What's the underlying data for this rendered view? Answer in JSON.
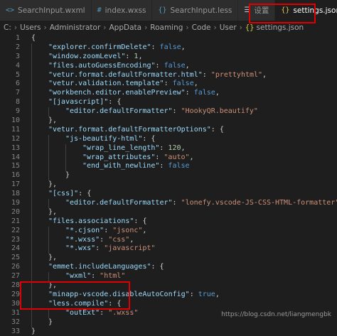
{
  "tabs": [
    {
      "label": "SearchInput.wxml",
      "icon": "file-code-icon",
      "active": false
    },
    {
      "label": "index.wxss",
      "icon": "hash-icon",
      "active": false
    },
    {
      "label": "SearchInput.less",
      "icon": "braces-icon",
      "active": false
    },
    {
      "label": "设置",
      "icon": "gear-icon",
      "active": false
    },
    {
      "label": "settings.json",
      "icon": "braces-icon",
      "active": true,
      "close_glyph": "×"
    }
  ],
  "breadcrumb": [
    "C:",
    "Users",
    "Administrator",
    "AppData",
    "Roaming",
    "Code",
    "User",
    "settings.json"
  ],
  "editor": {
    "line_numbers": [
      "1",
      "2",
      "3",
      "4",
      "5",
      "6",
      "7",
      "8",
      "9",
      "10",
      "11",
      "12",
      "13",
      "14",
      "15",
      "16",
      "17",
      "18",
      "19",
      "20",
      "21",
      "22",
      "23",
      "24",
      "25",
      "26",
      "27",
      "28",
      "29",
      "30",
      "31",
      "32",
      "33"
    ],
    "lines": [
      {
        "indent": 0,
        "parts": [
          {
            "t": "punc",
            "v": "{"
          }
        ]
      },
      {
        "indent": 1,
        "parts": [
          {
            "t": "key",
            "v": "\"explorer.confirmDelete\""
          },
          {
            "t": "punc",
            "v": ": "
          },
          {
            "t": "bool",
            "v": "false"
          },
          {
            "t": "punc",
            "v": ","
          }
        ]
      },
      {
        "indent": 1,
        "parts": [
          {
            "t": "key",
            "v": "\"window.zoomLevel\""
          },
          {
            "t": "punc",
            "v": ": "
          },
          {
            "t": "num",
            "v": "1"
          },
          {
            "t": "punc",
            "v": ","
          }
        ]
      },
      {
        "indent": 1,
        "parts": [
          {
            "t": "key",
            "v": "\"files.autoGuessEncoding\""
          },
          {
            "t": "punc",
            "v": ": "
          },
          {
            "t": "bool",
            "v": "false"
          },
          {
            "t": "punc",
            "v": ","
          }
        ]
      },
      {
        "indent": 1,
        "parts": [
          {
            "t": "key",
            "v": "\"vetur.format.defaultFormatter.html\""
          },
          {
            "t": "punc",
            "v": ": "
          },
          {
            "t": "str",
            "v": "\"prettyhtml\""
          },
          {
            "t": "punc",
            "v": ","
          }
        ]
      },
      {
        "indent": 1,
        "parts": [
          {
            "t": "key",
            "v": "\"vetur.validation.template\""
          },
          {
            "t": "punc",
            "v": ": "
          },
          {
            "t": "bool",
            "v": "false"
          },
          {
            "t": "punc",
            "v": ","
          }
        ]
      },
      {
        "indent": 1,
        "parts": [
          {
            "t": "key",
            "v": "\"workbench.editor.enablePreview\""
          },
          {
            "t": "punc",
            "v": ": "
          },
          {
            "t": "bool",
            "v": "false"
          },
          {
            "t": "punc",
            "v": ","
          }
        ]
      },
      {
        "indent": 1,
        "parts": [
          {
            "t": "key",
            "v": "\"[javascript]\""
          },
          {
            "t": "punc",
            "v": ": {"
          }
        ]
      },
      {
        "indent": 2,
        "parts": [
          {
            "t": "key",
            "v": "\"editor.defaultFormatter\""
          },
          {
            "t": "punc",
            "v": ": "
          },
          {
            "t": "str",
            "v": "\"HookyQR.beautify\""
          }
        ]
      },
      {
        "indent": 1,
        "parts": [
          {
            "t": "punc",
            "v": "},"
          }
        ]
      },
      {
        "indent": 1,
        "parts": [
          {
            "t": "key",
            "v": "\"vetur.format.defaultFormatterOptions\""
          },
          {
            "t": "punc",
            "v": ": {"
          }
        ]
      },
      {
        "indent": 2,
        "parts": [
          {
            "t": "key",
            "v": "\"js-beautify-html\""
          },
          {
            "t": "punc",
            "v": ": {"
          }
        ]
      },
      {
        "indent": 3,
        "parts": [
          {
            "t": "key",
            "v": "\"wrap_line_length\""
          },
          {
            "t": "punc",
            "v": ": "
          },
          {
            "t": "num",
            "v": "120"
          },
          {
            "t": "punc",
            "v": ","
          }
        ]
      },
      {
        "indent": 3,
        "parts": [
          {
            "t": "key",
            "v": "\"wrap_attributes\""
          },
          {
            "t": "punc",
            "v": ": "
          },
          {
            "t": "str",
            "v": "\"auto\""
          },
          {
            "t": "punc",
            "v": ","
          }
        ]
      },
      {
        "indent": 3,
        "parts": [
          {
            "t": "key",
            "v": "\"end_with_newline\""
          },
          {
            "t": "punc",
            "v": ": "
          },
          {
            "t": "bool",
            "v": "false"
          }
        ]
      },
      {
        "indent": 2,
        "parts": [
          {
            "t": "punc",
            "v": "}"
          }
        ]
      },
      {
        "indent": 1,
        "parts": [
          {
            "t": "punc",
            "v": "},"
          }
        ]
      },
      {
        "indent": 1,
        "parts": [
          {
            "t": "key",
            "v": "\"[css]\""
          },
          {
            "t": "punc",
            "v": ": {"
          }
        ]
      },
      {
        "indent": 2,
        "parts": [
          {
            "t": "key",
            "v": "\"editor.defaultFormatter\""
          },
          {
            "t": "punc",
            "v": ": "
          },
          {
            "t": "str",
            "v": "\"lonefy.vscode-JS-CSS-HTML-formatter\""
          }
        ]
      },
      {
        "indent": 1,
        "parts": [
          {
            "t": "punc",
            "v": "},"
          }
        ]
      },
      {
        "indent": 1,
        "parts": [
          {
            "t": "key",
            "v": "\"files.associations\""
          },
          {
            "t": "punc",
            "v": ": {"
          }
        ]
      },
      {
        "indent": 2,
        "parts": [
          {
            "t": "key",
            "v": "\"*.cjson\""
          },
          {
            "t": "punc",
            "v": ": "
          },
          {
            "t": "str",
            "v": "\"jsonc\""
          },
          {
            "t": "punc",
            "v": ","
          }
        ]
      },
      {
        "indent": 2,
        "parts": [
          {
            "t": "key",
            "v": "\"*.wxss\""
          },
          {
            "t": "punc",
            "v": ": "
          },
          {
            "t": "str",
            "v": "\"css\""
          },
          {
            "t": "punc",
            "v": ","
          }
        ]
      },
      {
        "indent": 2,
        "parts": [
          {
            "t": "key",
            "v": "\"*.wxs\""
          },
          {
            "t": "punc",
            "v": ": "
          },
          {
            "t": "str",
            "v": "\"javascript\""
          }
        ]
      },
      {
        "indent": 1,
        "parts": [
          {
            "t": "punc",
            "v": "},"
          }
        ]
      },
      {
        "indent": 1,
        "parts": [
          {
            "t": "key",
            "v": "\"emmet.includeLanguages\""
          },
          {
            "t": "punc",
            "v": ": {"
          }
        ]
      },
      {
        "indent": 2,
        "parts": [
          {
            "t": "key",
            "v": "\"wxml\""
          },
          {
            "t": "punc",
            "v": ": "
          },
          {
            "t": "str",
            "v": "\"html\""
          }
        ]
      },
      {
        "indent": 1,
        "parts": [
          {
            "t": "punc",
            "v": "},"
          }
        ]
      },
      {
        "indent": 1,
        "parts": [
          {
            "t": "key",
            "v": "\"minapp-vscode.disableAutoConfig\""
          },
          {
            "t": "punc",
            "v": ": "
          },
          {
            "t": "bool",
            "v": "true"
          },
          {
            "t": "punc",
            "v": ","
          }
        ]
      },
      {
        "indent": 1,
        "parts": [
          {
            "t": "key",
            "v": "\"less.compile\""
          },
          {
            "t": "punc",
            "v": ": {"
          }
        ]
      },
      {
        "indent": 2,
        "parts": [
          {
            "t": "key",
            "v": "\"outExt\""
          },
          {
            "t": "punc",
            "v": ": "
          },
          {
            "t": "str",
            "v": "\".wxss\""
          }
        ]
      },
      {
        "indent": 1,
        "parts": [
          {
            "t": "punc",
            "v": "}"
          }
        ]
      },
      {
        "indent": 0,
        "parts": [
          {
            "t": "punc",
            "v": "}"
          }
        ]
      }
    ]
  },
  "watermark": "https://blog.csdn.net/liangmengbk",
  "colors": {
    "background": "#1e1e1e",
    "key": "#9cdcfe",
    "string": "#ce9178",
    "keyword": "#569cd6",
    "number": "#b5cea8",
    "highlight": "#e00000"
  }
}
